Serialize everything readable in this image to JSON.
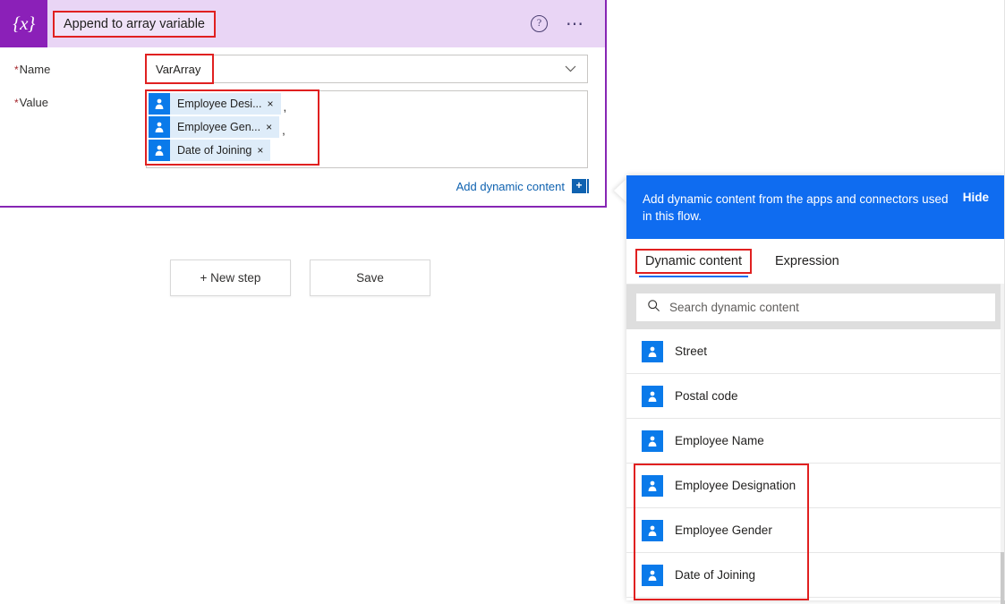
{
  "action_card": {
    "icon": "variable-braces-icon",
    "title": "Append to array variable",
    "help_icon": "help-circle-icon",
    "more_icon": "ellipsis-icon",
    "accent_purple": "#8b20b8",
    "header_bg": "#e9d5f5",
    "highlight_red": "#e02020",
    "fields": {
      "name": {
        "label": "Name",
        "required_marker": "*",
        "value": "VarArray",
        "chevron_icon": "chevron-down-icon"
      },
      "value": {
        "label": "Value",
        "required_marker": "*",
        "chips": [
          {
            "icon": "person-icon",
            "text": "Employee Desi...",
            "close_icon": "×",
            "separator": ","
          },
          {
            "icon": "person-icon",
            "text": "Employee Gen...",
            "close_icon": "×",
            "separator": ","
          },
          {
            "icon": "person-icon",
            "text": "Date of Joining",
            "close_icon": "×",
            "separator": ""
          }
        ]
      }
    },
    "add_dynamic_content": {
      "label": "Add dynamic content",
      "icon": "add-plus-badge-icon"
    }
  },
  "buttons": {
    "new_step": "+ New step",
    "save": "Save"
  },
  "dynamic_panel": {
    "caret_icon": "collapse-left-caret-icon",
    "banner": {
      "text": "Add dynamic content from the apps and connectors used in this flow.",
      "hide_label": "Hide",
      "bg": "#0f6cf0"
    },
    "tabs": [
      {
        "label": "Dynamic content",
        "active": true
      },
      {
        "label": "Expression",
        "active": false
      }
    ],
    "search": {
      "icon": "search-icon",
      "placeholder": "Search dynamic content",
      "value": ""
    },
    "items": [
      {
        "icon": "person-icon",
        "label": "Street"
      },
      {
        "icon": "person-icon",
        "label": "Postal code"
      },
      {
        "icon": "person-icon",
        "label": "Employee Name"
      },
      {
        "icon": "person-icon",
        "label": "Employee Designation"
      },
      {
        "icon": "person-icon",
        "label": "Employee Gender"
      },
      {
        "icon": "person-icon",
        "label": "Date of Joining"
      }
    ],
    "icon_blue": "#0a7aea"
  }
}
